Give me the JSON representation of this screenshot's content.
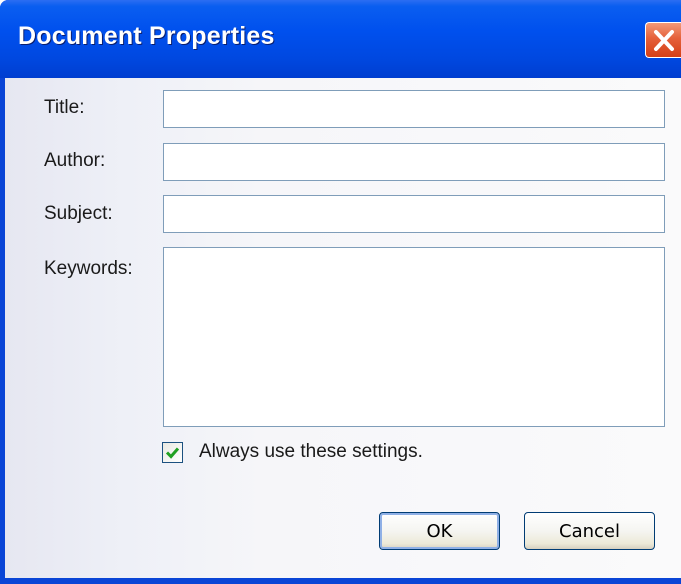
{
  "window": {
    "title": "Document Properties"
  },
  "fields": {
    "title": {
      "label": "Title:",
      "value": ""
    },
    "author": {
      "label": "Author:",
      "value": ""
    },
    "subject": {
      "label": "Subject:",
      "value": ""
    },
    "keywords": {
      "label": "Keywords:",
      "value": ""
    }
  },
  "checkbox": {
    "label": "Always use these settings.",
    "checked": true
  },
  "buttons": {
    "ok": "OK",
    "cancel": "Cancel"
  },
  "icons": {
    "close": "close-icon",
    "check": "checkmark-icon"
  },
  "colors": {
    "titlebar": "#0050ee",
    "close": "#e5603a",
    "check": "#21a121"
  }
}
